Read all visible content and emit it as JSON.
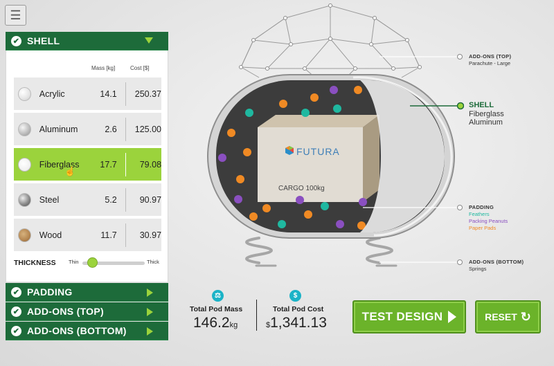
{
  "menu": {
    "icon": "hamburger-menu-icon",
    "glyph": "☰"
  },
  "sections": {
    "shell": {
      "title": "SHELL",
      "expanded": true
    },
    "padding": {
      "title": "PADDING"
    },
    "addons_top": {
      "title": "ADD-ONS (TOP)"
    },
    "addons_bottom": {
      "title": "ADD-ONS (BOTTOM)"
    }
  },
  "shell_table": {
    "col_mass": "Mass [kg]",
    "col_cost": "Cost [$]",
    "rows": [
      {
        "name": "Acrylic",
        "mass": "14.1",
        "cost": "250.37",
        "selected": false
      },
      {
        "name": "Aluminum",
        "mass": "2.6",
        "cost": "125.00",
        "selected": false
      },
      {
        "name": "Fiberglass",
        "mass": "17.7",
        "cost": "79.08",
        "selected": true
      },
      {
        "name": "Steel",
        "mass": "5.2",
        "cost": "90.97",
        "selected": false
      },
      {
        "name": "Wood",
        "mass": "11.7",
        "cost": "30.97",
        "selected": false
      }
    ]
  },
  "thickness": {
    "label": "THICKNESS",
    "min_label": "Thin",
    "max_label": "Thick",
    "value_fraction": 0.15
  },
  "pod": {
    "brand": "FUTURA",
    "cargo_label": "CARGO  100kg"
  },
  "callouts": {
    "addons_top": {
      "title": "ADD-ONS (TOP)",
      "value": "Parachute - Large"
    },
    "shell": {
      "title": "SHELL",
      "line1": "Fiberglass",
      "line2": "Aluminum"
    },
    "padding": {
      "title": "PADDING",
      "items": [
        "Feathers",
        "Packing Peanuts",
        "Paper Pads"
      ]
    },
    "addons_bottom": {
      "title": "ADD-ONS (BOTTOM)",
      "value": "Springs"
    }
  },
  "totals": {
    "mass_label": "Total Pod Mass",
    "mass_value": "146.2",
    "mass_unit": "kg",
    "cost_label": "Total Pod Cost",
    "cost_symbol": "$",
    "cost_value": "1,341.13"
  },
  "buttons": {
    "test": "TEST DESIGN",
    "reset": "RESET"
  },
  "colors": {
    "dark_green": "#1d6b3a",
    "lime": "#9bd33c",
    "button_green": "#6bb32a",
    "teal": "#1bb3c7"
  }
}
